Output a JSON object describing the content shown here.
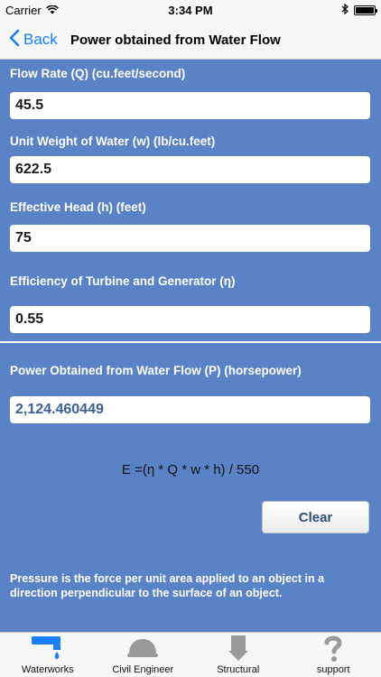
{
  "status_bar": {
    "carrier": "Carrier",
    "time": "3:34 PM"
  },
  "nav": {
    "back_label": "Back",
    "title": "Power obtained from Water Flow"
  },
  "form": {
    "flow_rate": {
      "label": "Flow Rate (Q) (cu.feet/second)",
      "value": "45.5"
    },
    "unit_weight": {
      "label": "Unit Weight of Water (w) (lb/cu.feet)",
      "value": "622.5"
    },
    "effective_head": {
      "label": "Effective Head (h) (feet)",
      "value": "75"
    },
    "efficiency": {
      "label": "Efficiency of Turbine and Generator (η)",
      "value": "0.55"
    }
  },
  "result": {
    "label": "Power Obtained from Water Flow (P) (horsepower)",
    "value": "2,124.460449"
  },
  "formula": "E =(η * Q * w * h) / 550",
  "clear_label": "Clear",
  "description": "Pressure is the force per unit area applied to an object in a direction perpendicular to the surface of an object.",
  "tabs": [
    {
      "label": "Waterworks",
      "icon": "waterworks-icon",
      "color": "#1a7dfb"
    },
    {
      "label": "Civil Engineer",
      "icon": "hard-hat-icon",
      "color": "#9a9a9a"
    },
    {
      "label": "Structural",
      "icon": "structural-icon",
      "color": "#9a9a9a"
    },
    {
      "label": "support",
      "icon": "question-icon",
      "color": "#9a9a9a"
    }
  ],
  "colors": {
    "accent": "#1a7dfb",
    "panel": "#5a82c6",
    "result_text": "#3a5f92"
  }
}
